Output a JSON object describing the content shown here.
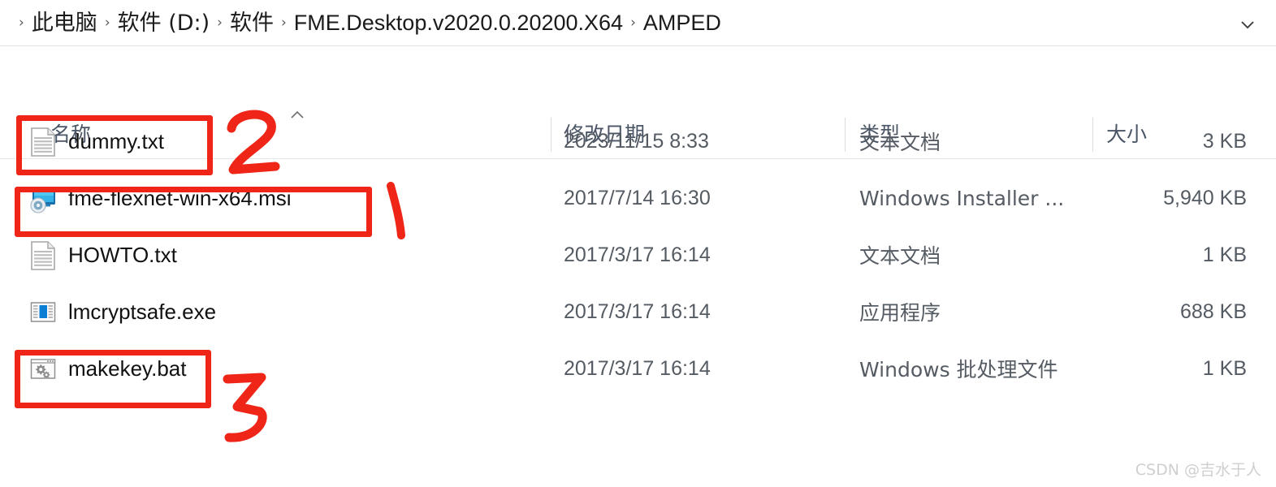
{
  "window": {
    "breadcrumb": {
      "leading_separator": "›",
      "separator": "›",
      "items": [
        {
          "label": "此电脑",
          "cn": true
        },
        {
          "label": "软件 (D:)",
          "cn": true
        },
        {
          "label": "软件",
          "cn": true
        },
        {
          "label": "FME.Desktop.v2020.0.20200.X64",
          "cn": false
        },
        {
          "label": "AMPED",
          "cn": false
        }
      ],
      "dropdown_icon": "chevron-down-icon"
    }
  },
  "columns": {
    "name": "名称",
    "date_modified": "修改日期",
    "type": "类型",
    "size": "大小",
    "sort_indicator": "sort-ascending-icon"
  },
  "files": [
    {
      "name": "dummy.txt",
      "icon": "text-document-icon",
      "date": "2023/11/15 8:33",
      "type": "文本文档",
      "size": "3 KB",
      "cn_type": true
    },
    {
      "name": "fme-flexnet-win-x64.msi",
      "icon": "windows-installer-icon",
      "date": "2017/7/14 16:30",
      "type": "Windows Installer ...",
      "size": "5,940 KB",
      "cn_type": false
    },
    {
      "name": "HOWTO.txt",
      "icon": "text-document-icon",
      "date": "2017/3/17 16:14",
      "type": "文本文档",
      "size": "1 KB",
      "cn_type": true
    },
    {
      "name": "lmcryptsafe.exe",
      "icon": "application-exe-icon",
      "date": "2017/3/17 16:14",
      "type": "应用程序",
      "size": "688 KB",
      "cn_type": true
    },
    {
      "name": "makekey.bat",
      "icon": "batch-file-icon",
      "date": "2017/3/17 16:14",
      "type": "Windows 批处理文件",
      "size": "1 KB",
      "cn_type": true
    }
  ],
  "annotations": {
    "color": "#ef2517",
    "marks": [
      {
        "label": "2",
        "target": "dummy.txt"
      },
      {
        "label": "1",
        "target": "fme-flexnet-win-x64.msi"
      },
      {
        "label": "3",
        "target": "makekey.bat"
      }
    ]
  },
  "watermark": {
    "text": "CSDN @吉水于人"
  }
}
